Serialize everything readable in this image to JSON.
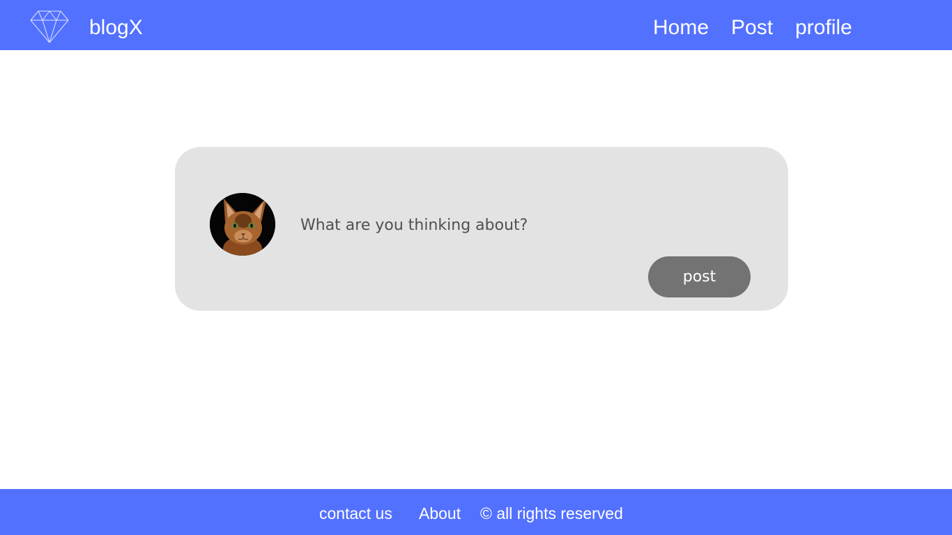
{
  "header": {
    "brand": "blogX",
    "logo_icon": "diamond-icon",
    "nav": {
      "home": "Home",
      "post": "Post",
      "profile": "profile"
    }
  },
  "composer": {
    "placeholder": "What are you thinking about?",
    "value": "",
    "avatar": "cat-avatar",
    "post_label": "post"
  },
  "footer": {
    "contact": "contact us",
    "about": "About",
    "rights": "© all rights reserved"
  },
  "colors": {
    "brand_blue": "#5371ff",
    "card_bg": "#e3e3e3",
    "button_gray": "#737373"
  }
}
